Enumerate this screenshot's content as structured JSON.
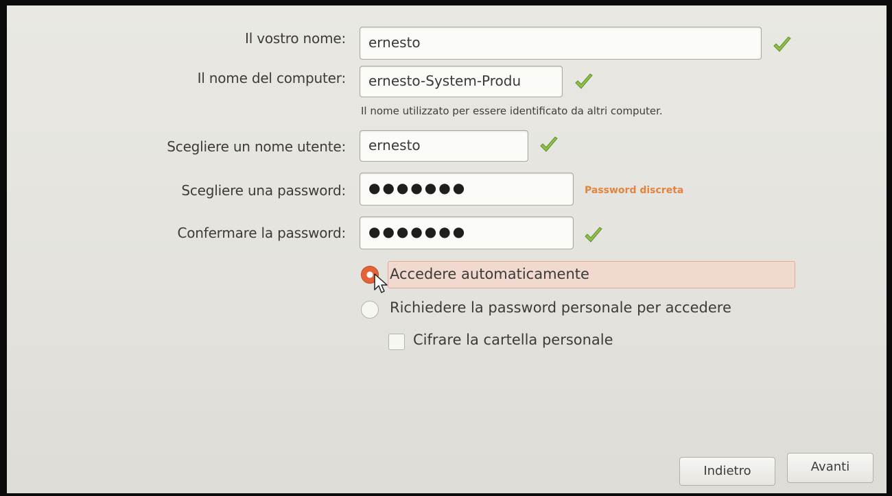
{
  "form": {
    "your_name": {
      "label": "Il vostro nome:",
      "value": "ernesto",
      "valid": true
    },
    "computer_name": {
      "label": "Il nome del computer:",
      "value": "ernesto-System-Produ",
      "valid": true,
      "hint": "Il nome utilizzato per essere identificato da altri computer."
    },
    "username": {
      "label": "Scegliere un nome utente:",
      "value": "ernesto",
      "valid": true
    },
    "password": {
      "label": "Scegliere una password:",
      "value": "●●●●●●●",
      "strength": "Password discreta"
    },
    "confirm_password": {
      "label": "Confermare la password:",
      "value": "●●●●●●●",
      "valid": true
    }
  },
  "login_options": {
    "auto_login": {
      "label": "Accedere automaticamente",
      "selected": true
    },
    "require_password": {
      "label": "Richiedere la password personale per accedere",
      "selected": false
    },
    "encrypt_home": {
      "label": "Cifrare la cartella personale",
      "checked": false
    }
  },
  "buttons": {
    "back": "Indietro",
    "forward": "Avanti"
  },
  "colors": {
    "accent": "#e36239",
    "check": "#7cae3a",
    "strength": "#e2843d"
  }
}
